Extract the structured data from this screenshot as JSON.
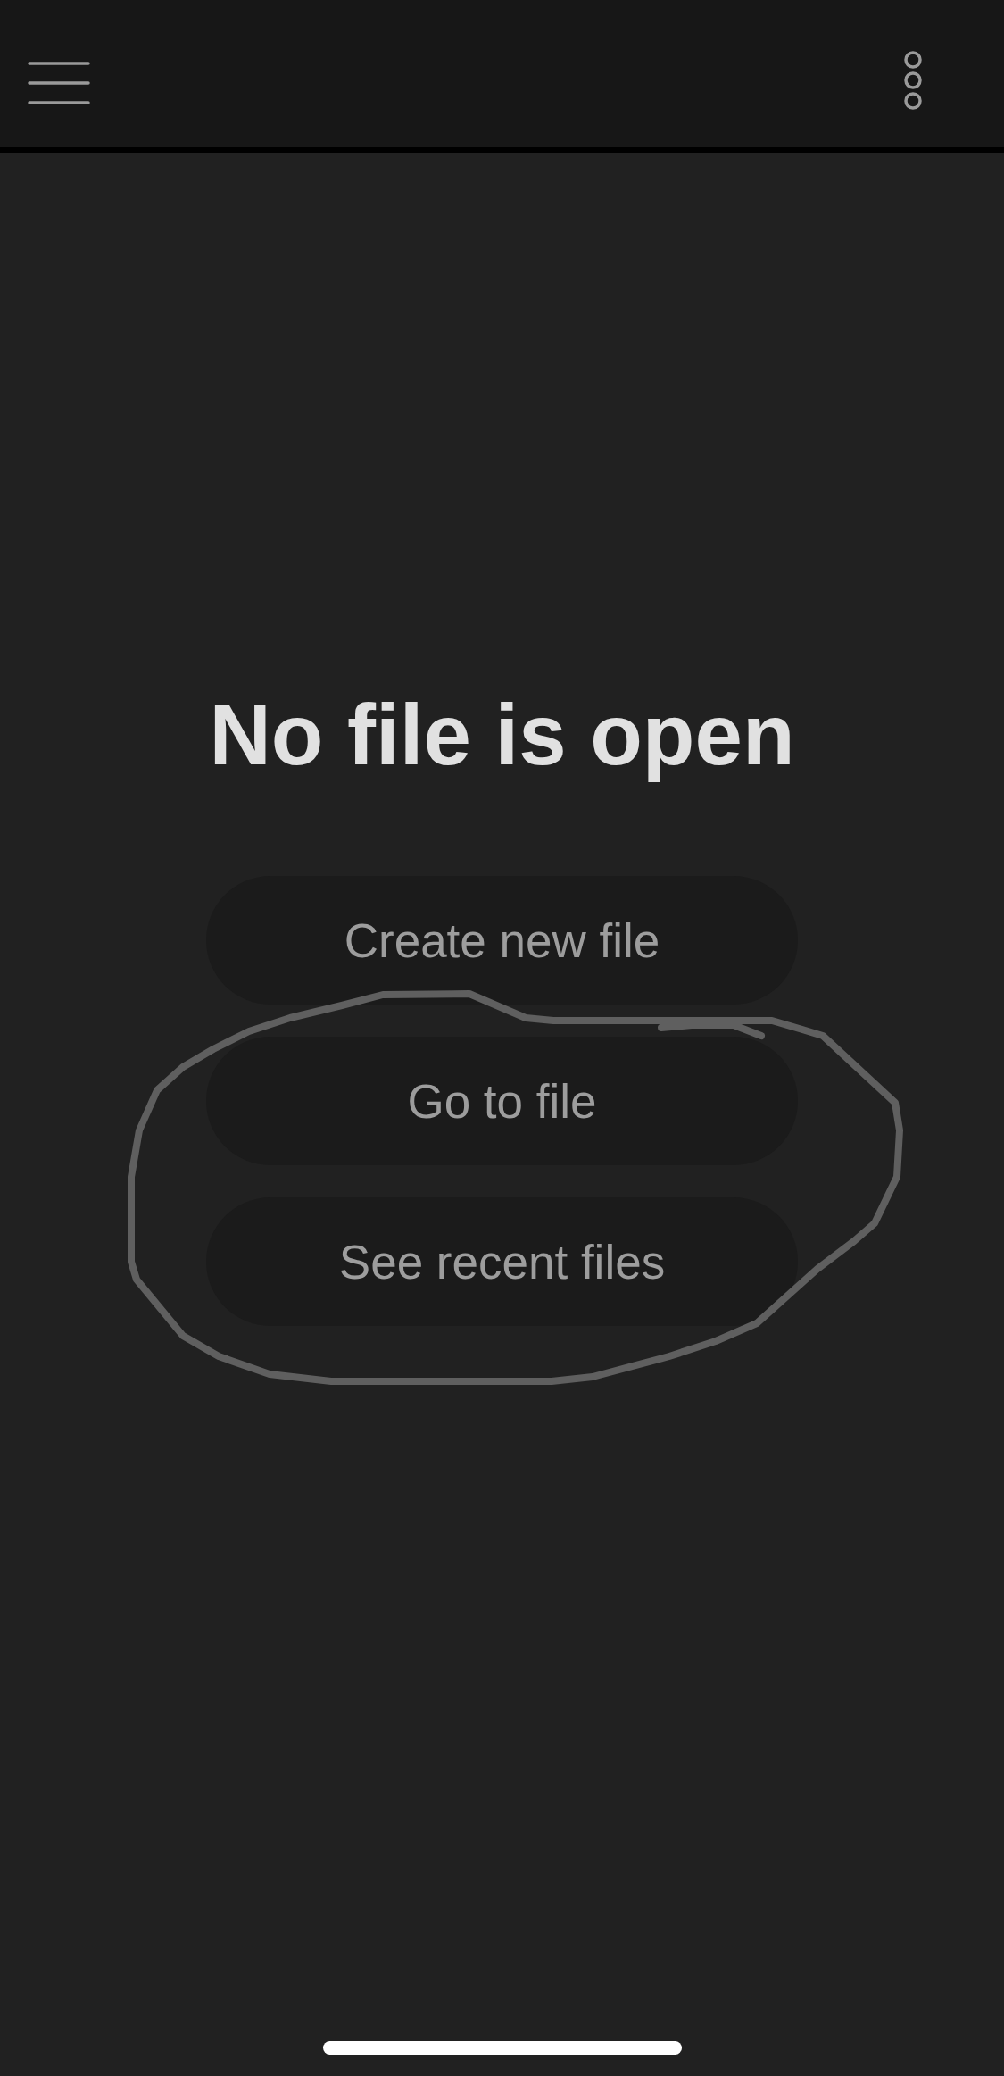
{
  "empty_state": {
    "title": "No file is open",
    "actions": [
      "Create new file",
      "Go to file",
      "See recent files"
    ]
  }
}
